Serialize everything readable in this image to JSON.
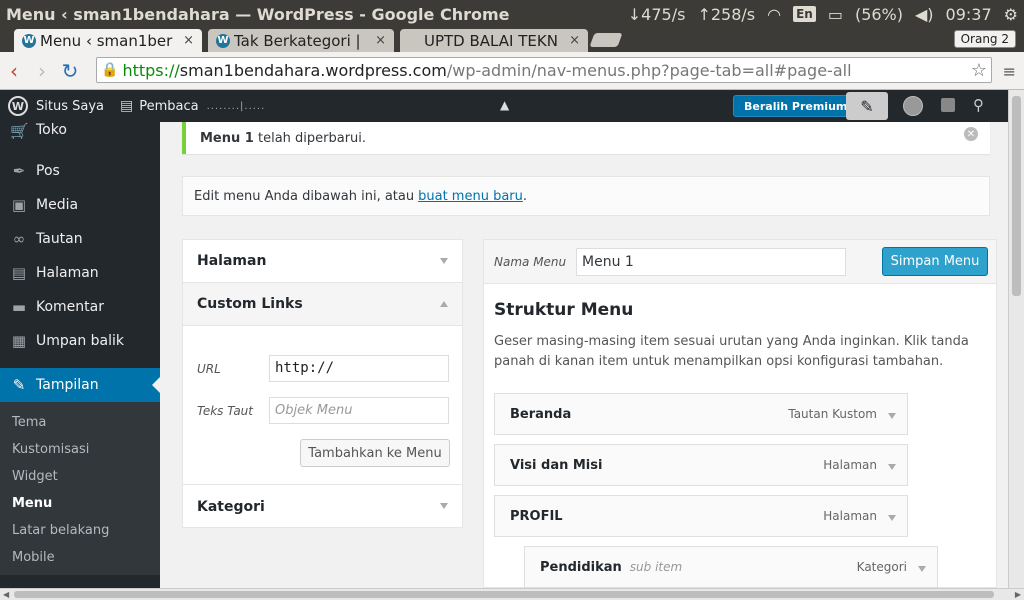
{
  "os": {
    "window_title": "Menu ‹ sman1bendahara — WordPress - Google Chrome",
    "net_down": "↓475/s",
    "net_up": "↑258/s",
    "lang": "En",
    "battery": "(56%)",
    "time": "09:37"
  },
  "browser": {
    "tabs": [
      {
        "label": "Menu ‹ sman1ber",
        "close": "×"
      },
      {
        "label": "Tak Berkategori |",
        "close": "×"
      },
      {
        "label": "UPTD BALAI TEKN",
        "close": "×"
      }
    ],
    "profile": "Orang 2",
    "url_https": "https://",
    "url_host": "sman1bendahara.wordpress.com",
    "url_path": "/wp-admin/nav-menus.php?page-tab=all#page-all"
  },
  "adminbar": {
    "my_sites": "Situs Saya",
    "reader": "Pembaca",
    "premium": "Beralih Premium"
  },
  "sidebar": {
    "items": [
      {
        "label": "Toko",
        "icon": "cart-icon"
      },
      {
        "label": "Pos",
        "icon": "pin-icon"
      },
      {
        "label": "Media",
        "icon": "media-icon"
      },
      {
        "label": "Tautan",
        "icon": "link-icon"
      },
      {
        "label": "Halaman",
        "icon": "page-icon"
      },
      {
        "label": "Komentar",
        "icon": "comment-icon"
      },
      {
        "label": "Umpan balik",
        "icon": "feedback-icon"
      }
    ],
    "active": {
      "label": "Tampilan",
      "icon": "brush-icon"
    },
    "submenu": [
      "Tema",
      "Kustomisasi",
      "Widget",
      "Menu",
      "Latar belakang",
      "Mobile"
    ]
  },
  "notice": {
    "menu_name": "Menu 1",
    "text": "telah diperbarui."
  },
  "manage": {
    "text": "Edit menu Anda dibawah ini, atau",
    "link": "buat menu baru",
    "suffix": "."
  },
  "accordion": {
    "halaman": "Halaman",
    "custom_links": "Custom Links",
    "url_label": "URL",
    "url_value": "http://",
    "text_label": "Teks Taut",
    "text_placeholder": "Objek Menu",
    "add_button": "Tambahkan ke Menu",
    "kategori": "Kategori"
  },
  "menu_panel": {
    "name_label": "Nama Menu",
    "name_value": "Menu 1",
    "save_button": "Simpan Menu",
    "structure_title": "Struktur Menu",
    "structure_desc": "Geser masing-masing item sesuai urutan yang Anda inginkan. Klik tanda panah di kanan item untuk menampilkan opsi konfigurasi tambahan.",
    "items": [
      {
        "title": "Beranda",
        "sub": "",
        "type": "Tautan Kustom"
      },
      {
        "title": "Visi dan Misi",
        "sub": "",
        "type": "Halaman"
      },
      {
        "title": "PROFIL",
        "sub": "",
        "type": "Halaman"
      },
      {
        "title": "Pendidikan",
        "sub": "sub item",
        "type": "Kategori"
      }
    ]
  }
}
